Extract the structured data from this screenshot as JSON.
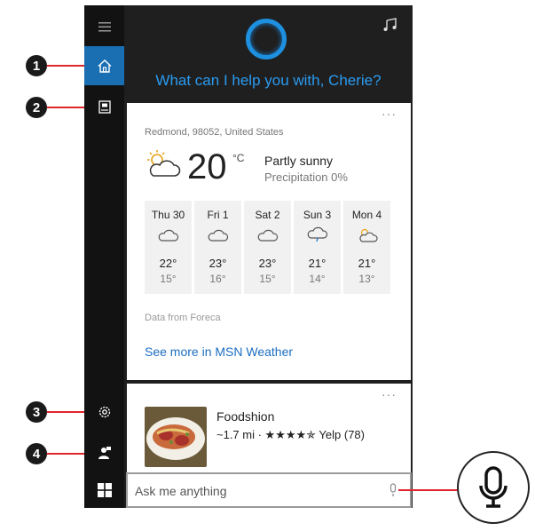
{
  "callouts": [
    "1",
    "2",
    "3",
    "4"
  ],
  "header": {
    "greeting": "What can I help you with, Cherie?"
  },
  "weather": {
    "location": "Redmond, 98052, United States",
    "temperature": "20",
    "unit": "°C",
    "condition": "Partly sunny",
    "precipitation": "Precipitation 0%",
    "forecast": [
      {
        "day": "Thu 30",
        "icon": "cloudy-icon",
        "high": "22°",
        "low": "15°"
      },
      {
        "day": "Fri 1",
        "icon": "cloudy-icon",
        "high": "23°",
        "low": "16°"
      },
      {
        "day": "Sat 2",
        "icon": "cloudy-icon",
        "high": "23°",
        "low": "15°"
      },
      {
        "day": "Sun 3",
        "icon": "rain-icon",
        "high": "21°",
        "low": "14°"
      },
      {
        "day": "Mon 4",
        "icon": "partly-sunny-icon",
        "high": "21°",
        "low": "13°"
      }
    ],
    "source": "Data from Foreca",
    "see_more": "See more in MSN Weather"
  },
  "food": {
    "name": "Foodshion",
    "details": "~1.7 mi · ★★★★✯ Yelp (78)"
  },
  "search": {
    "placeholder": "Ask me anything"
  },
  "more_label": "···",
  "colors": {
    "accent": "#1a6fb3",
    "greeting": "#2a9bf0",
    "link": "#1b6ec2",
    "callout_line": "#e0262c"
  }
}
